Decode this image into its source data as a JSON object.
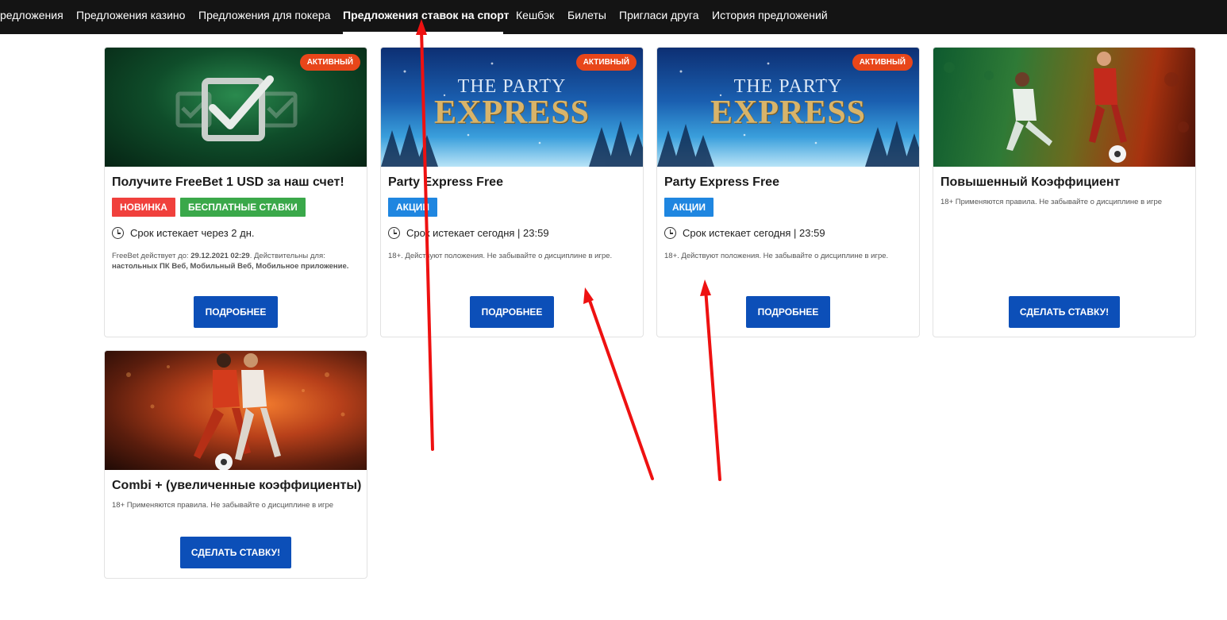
{
  "nav": {
    "items": [
      "редложения",
      "Предложения казино",
      "Предложения для покера",
      "Предложения ставок на спорт",
      "Кешбэк",
      "Билеты",
      "Пригласи друга",
      "История предложений"
    ],
    "active_index": 3
  },
  "colors": {
    "nav_bg": "#141414",
    "active_badge": "#e8461a",
    "button": "#0c4fb8",
    "tag_new": "#f0403c",
    "tag_free": "#3aa84a",
    "tag_promo": "#1f86e0",
    "annotation": "#ee1111"
  },
  "cards": [
    {
      "banner_icon": "checkmark-icon",
      "badge": "АКТИВНЫЙ",
      "title": "Получите FreeBet 1 USD за наш счет!",
      "tags": [
        "НОВИНКА",
        "БЕСПЛАТНЫЕ СТАВКИ"
      ],
      "expiry": "Срок истекает через 2 дн.",
      "note_prefix": "FreeBet действует до: ",
      "note_date": "29.12.2021 02:29",
      "note_mid": ". Действительны для: ",
      "note_platforms": "настольных ПК Веб, Мобильный Веб, Мобильное приложение.",
      "button": "ПОДРОБНЕЕ"
    },
    {
      "banner_line1": "THE PARTY",
      "banner_line2": "EXPRESS",
      "badge": "АКТИВНЫЙ",
      "title": "Party Express Free",
      "tags": [
        "АКЦИИ"
      ],
      "expiry": "Срок истекает сегодня | 23:59",
      "note": "18+. Действуют положения. Не забывайте о дисциплине в игре.",
      "button": "ПОДРОБНЕЕ"
    },
    {
      "banner_line1": "THE PARTY",
      "banner_line2": "EXPRESS",
      "badge": "АКТИВНЫЙ",
      "title": "Party Express Free",
      "tags": [
        "АКЦИИ"
      ],
      "expiry": "Срок истекает сегодня | 23:59",
      "note": "18+. Действуют положения. Не забывайте о дисциплине в игре.",
      "button": "ПОДРОБНЕЕ"
    },
    {
      "title": "Повышенный Коэффициент",
      "note": "18+ Применяются правила. Не забывайте о дисциплине в игре",
      "button": "СДЕЛАТЬ СТАВКУ!"
    },
    {
      "title": "Combi + (увеличенные коэффициенты)",
      "note": "18+ Применяются правила. Не забывайте о дисциплине в игре",
      "button": "СДЕЛАТЬ СТАВКУ!"
    }
  ]
}
